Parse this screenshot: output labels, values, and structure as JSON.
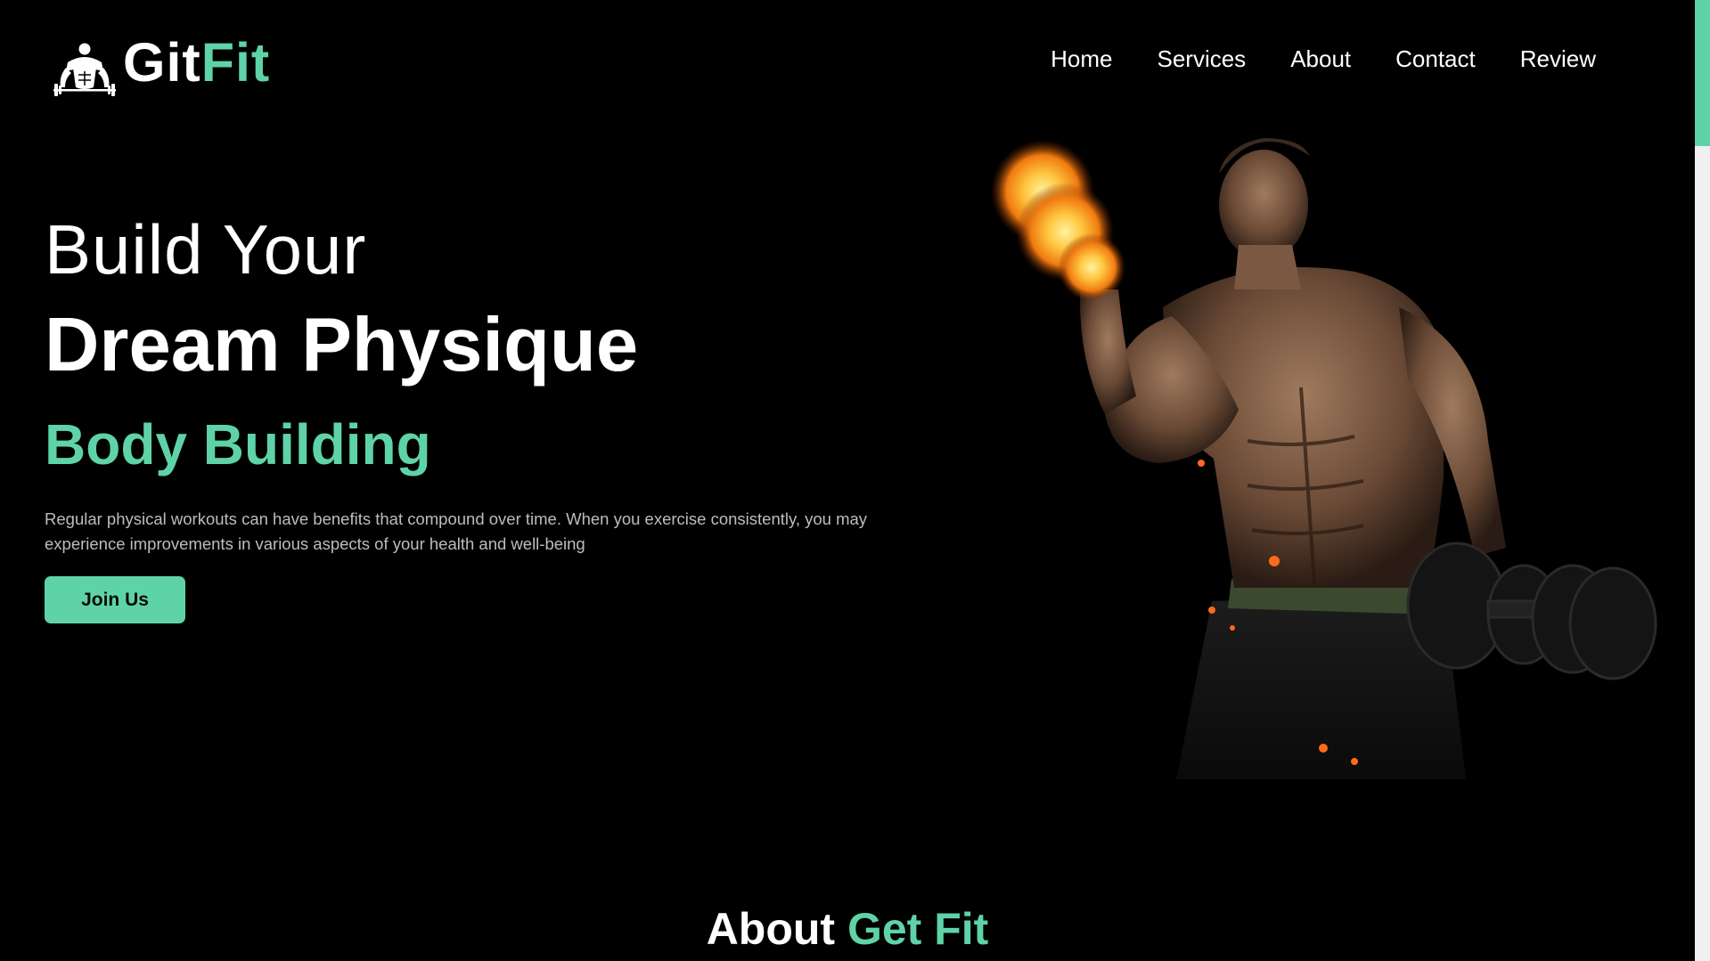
{
  "brand": {
    "name_part1": "Git",
    "name_part2": "Fit",
    "accent_color": "#5fd3a8"
  },
  "nav": {
    "items": [
      {
        "label": "Home"
      },
      {
        "label": "Services"
      },
      {
        "label": "About"
      },
      {
        "label": "Contact"
      },
      {
        "label": "Review"
      }
    ]
  },
  "hero": {
    "line1": "Build Your",
    "line2": "Dream Physique",
    "line3": "Body Building",
    "description": "Regular physical workouts can have benefits that compound over time. When you exercise consistently, you may experience improvements in various aspects of your health and well-being",
    "cta_label": "Join Us",
    "image_icon": "bodybuilder-with-flaming-dumbbell-image"
  },
  "about": {
    "heading_part1": "About",
    "heading_part2": "Get Fit"
  },
  "icons": {
    "logo": "bodybuilder-logo-icon"
  }
}
